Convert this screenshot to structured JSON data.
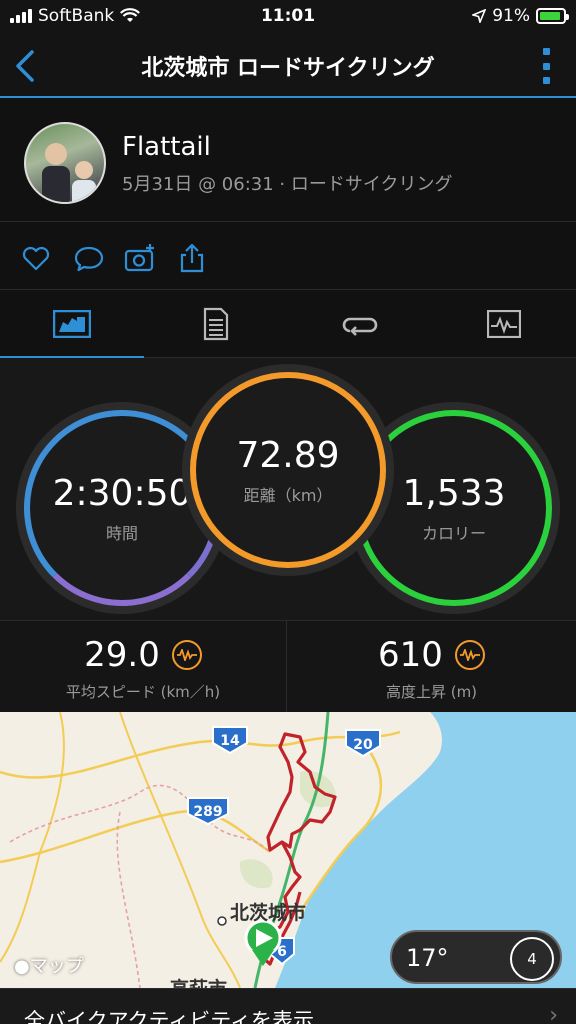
{
  "status": {
    "carrier": "SoftBank",
    "time": "11:01",
    "battery_percent": "91%",
    "battery_level": 0.91
  },
  "nav": {
    "title": "北茨城市 ロードサイクリング"
  },
  "profile": {
    "name": "Flattail",
    "meta": "5月31日 @ 06:31 · ロードサイクリング"
  },
  "tabs": [
    {
      "icon": "overview-icon",
      "active": true
    },
    {
      "icon": "details-icon",
      "active": false
    },
    {
      "icon": "laps-icon",
      "active": false
    },
    {
      "icon": "charts-icon",
      "active": false
    }
  ],
  "stats": {
    "time": {
      "value": "2:30:50",
      "label": "時間",
      "color": "#8a6fd0"
    },
    "distance": {
      "value": "72.89",
      "label": "距離（km）",
      "color": "#f39a2b"
    },
    "calories": {
      "value": "1,533",
      "label": "カロリー",
      "color": "#2bd13c"
    }
  },
  "substats": {
    "avg_speed": {
      "value": "29.0",
      "label": "平均スピード (km／h)"
    },
    "elevation_gain": {
      "value": "610",
      "label": "高度上昇 (m)"
    }
  },
  "map": {
    "city_label": "北茨城市",
    "bottom_label": "高萩市",
    "route_markers": [
      "14",
      "20",
      "289",
      "6"
    ],
    "attribution": "マップ",
    "temperature": "17°",
    "wind": "4"
  },
  "footer": {
    "text": "全バイクアクティビティを表示"
  },
  "colors": {
    "accent": "#2e8fd6",
    "route": "#c0232a",
    "water": "#8fd0ee",
    "land": "#f4efe4"
  }
}
